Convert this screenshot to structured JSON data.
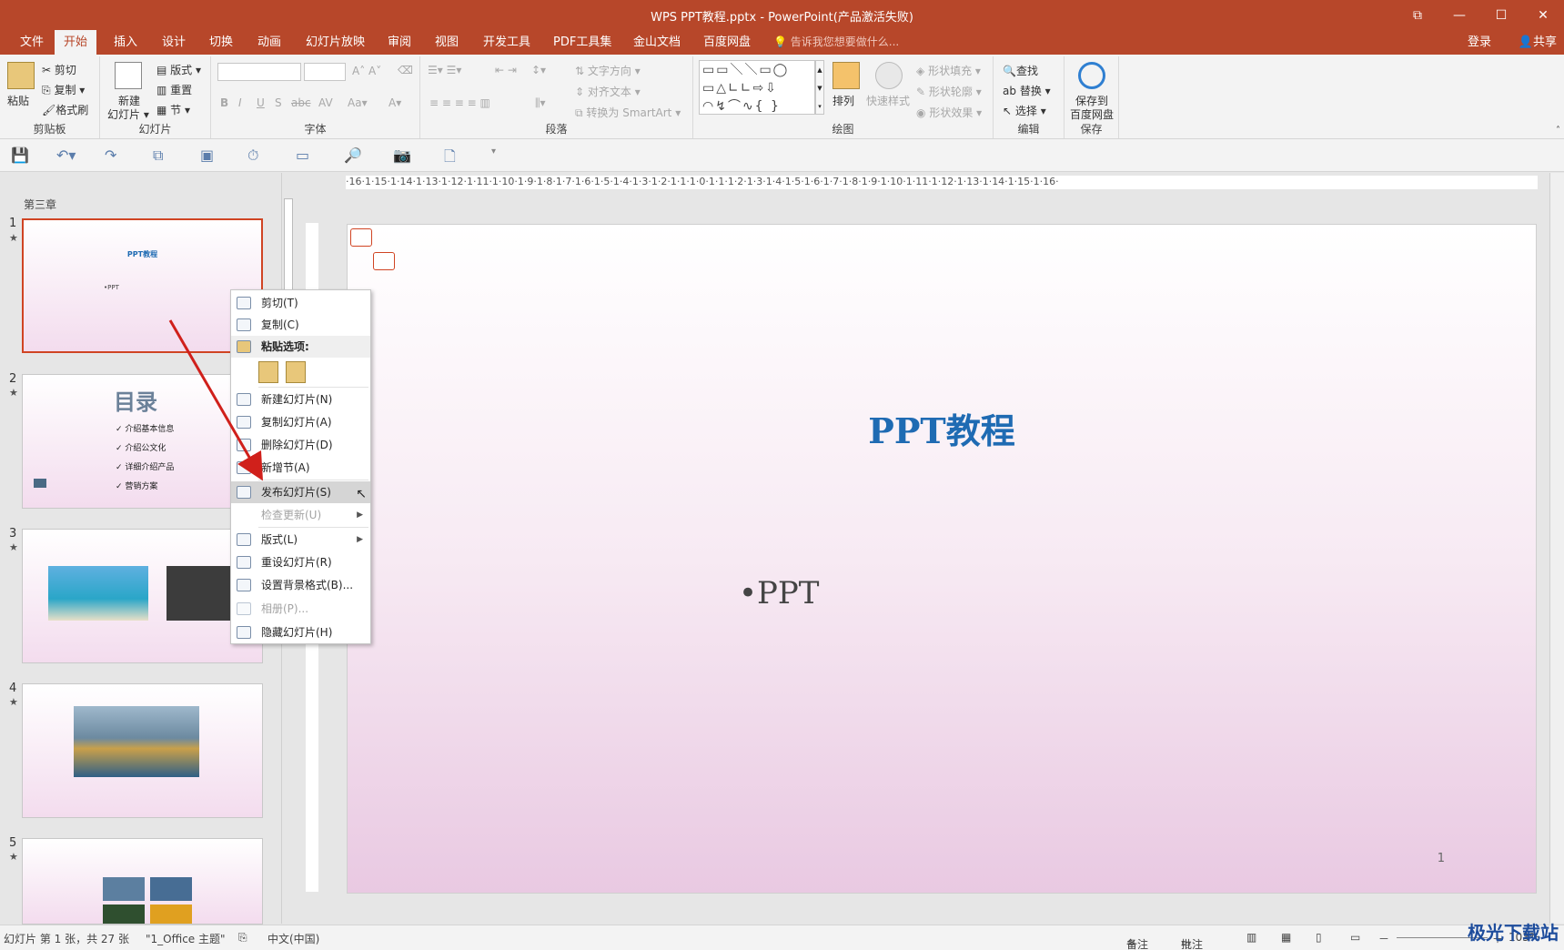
{
  "window": {
    "title": "WPS PPT教程.pptx - PowerPoint(产品激活失败)"
  },
  "menu": {
    "tabs": [
      "文件",
      "开始",
      "插入",
      "设计",
      "切换",
      "动画",
      "幻灯片放映",
      "审阅",
      "视图",
      "开发工具",
      "PDF工具集",
      "金山文档",
      "百度网盘"
    ],
    "active": "开始",
    "tellme": "告诉我您想要做什么...",
    "login": "登录",
    "share": "共享"
  },
  "ribbon": {
    "clipboard": {
      "paste": "粘贴",
      "cut": "剪切",
      "copy": "复制",
      "format_painter": "格式刷",
      "label": "剪贴板"
    },
    "slides": {
      "new_slide": "新建",
      "new_slide2": "幻灯片",
      "layout": "版式",
      "reset": "重置",
      "section": "节",
      "label": "幻灯片"
    },
    "font": {
      "label": "字体"
    },
    "paragraph": {
      "text_direction": "文字方向",
      "align_text": "对齐文本",
      "smartart": "转换为 SmartArt",
      "label": "段落"
    },
    "drawing": {
      "arrange": "排列",
      "quick_styles": "快速样式",
      "shape_fill": "形状填充",
      "shape_outline": "形状轮廓",
      "shape_effects": "形状效果",
      "label": "绘图"
    },
    "editing": {
      "find": "查找",
      "replace": "替换",
      "select": "选择",
      "label": "编辑"
    },
    "save": {
      "save_to": "保存到",
      "baidu": "百度网盘",
      "label": "保存"
    }
  },
  "slides_pane": {
    "section": "第三章",
    "thumbs": [
      {
        "num": "1",
        "title": "PPT教程",
        "body": "•PPT"
      },
      {
        "num": "2",
        "title": "目录",
        "items": [
          "介绍基本信息",
          "介绍公文化",
          "详细介绍产品",
          "营销方案"
        ]
      },
      {
        "num": "3"
      },
      {
        "num": "4"
      },
      {
        "num": "5"
      }
    ]
  },
  "ruler": {
    "h": "·16·1·15·1·14·1·13·1·12·1·11·1·10·1·9·1·8·1·7·1·6·1·5·1·4·1·3·1·2·1·1·1·0·1·1·1·2·1·3·1·4·1·5·1·6·1·7·1·8·1·9·1·10·1·11·1·12·1·13·1·14·1·15·1·16·"
  },
  "slide": {
    "title": "PPT教程",
    "body": "•PPT",
    "page": "1"
  },
  "context_menu": {
    "cut": "剪切(T)",
    "copy": "复制(C)",
    "paste_options": "粘贴选项:",
    "new_slide": "新建幻灯片(N)",
    "duplicate_slide": "复制幻灯片(A)",
    "delete_slide": "删除幻灯片(D)",
    "add_section": "新增节(A)",
    "publish_slides": "发布幻灯片(S)",
    "check_updates": "检查更新(U)",
    "layout": "版式(L)",
    "reset_slide": "重设幻灯片(R)",
    "format_background": "设置背景格式(B)...",
    "photo_album": "相册(P)...",
    "hide_slide": "隐藏幻灯片(H)"
  },
  "status": {
    "slide_info": "幻灯片 第 1 张，共 27 张",
    "theme": "\"1_Office 主题\"",
    "language": "中文(中国)",
    "notes": "备注",
    "comments": "批注",
    "zoom": "103%"
  },
  "watermark": "极光下载站",
  "colors": {
    "accent": "#b7472a",
    "title_blue": "#1f6bb3",
    "arrow": "#d0201b"
  }
}
